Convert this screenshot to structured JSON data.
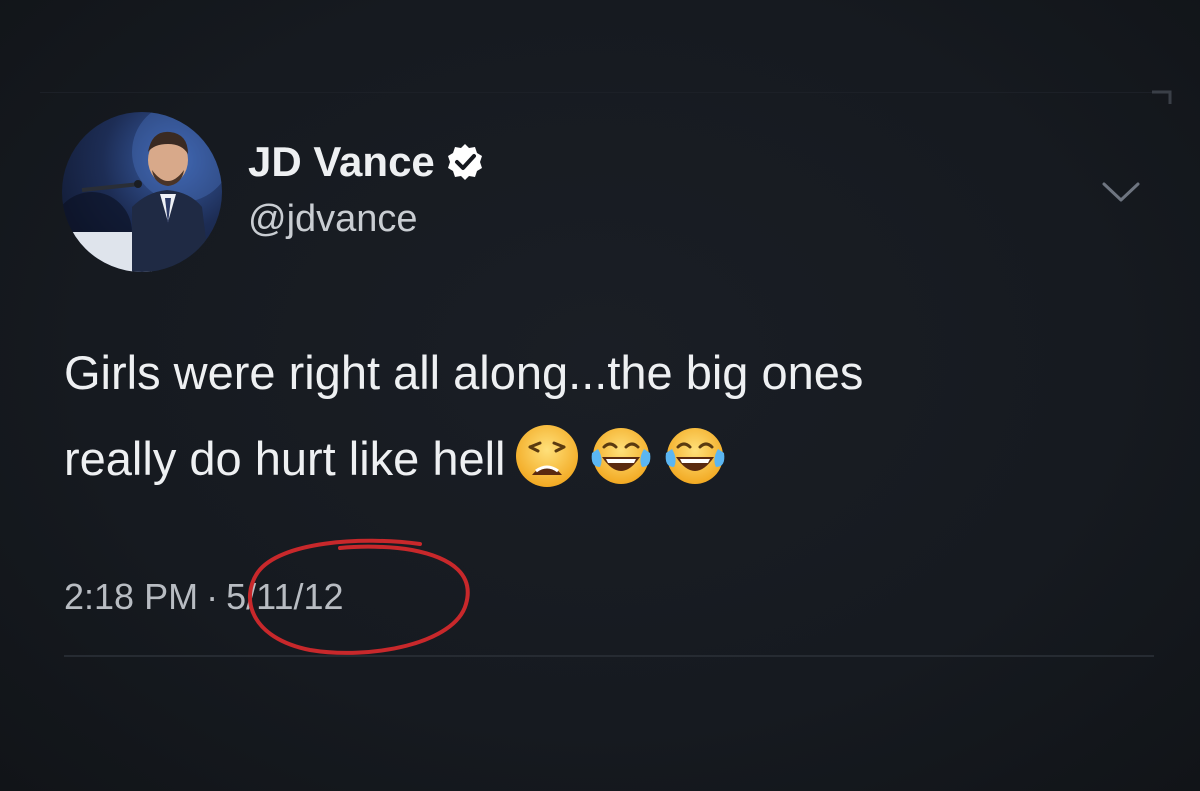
{
  "tweet": {
    "author": {
      "display_name": "JD Vance",
      "handle": "@jdvance",
      "verified": true,
      "avatar_icon": "profile-photo"
    },
    "text_line_1": "Girls were right all along...the big ones",
    "text_line_2": "really do hurt like hell",
    "emojis": [
      "weary-face-emoji",
      "face-with-tears-of-joy-emoji",
      "face-with-tears-of-joy-emoji"
    ],
    "time": "2:18 PM",
    "separator": "·",
    "date": "5/11/12",
    "menu_icon": "chevron-down-icon"
  },
  "colors": {
    "background": "#161a20",
    "text_primary": "#eef0f2",
    "text_secondary": "#b8bcc2",
    "verified_badge": "#ffffff",
    "annotation_circle": "#c8282b"
  }
}
